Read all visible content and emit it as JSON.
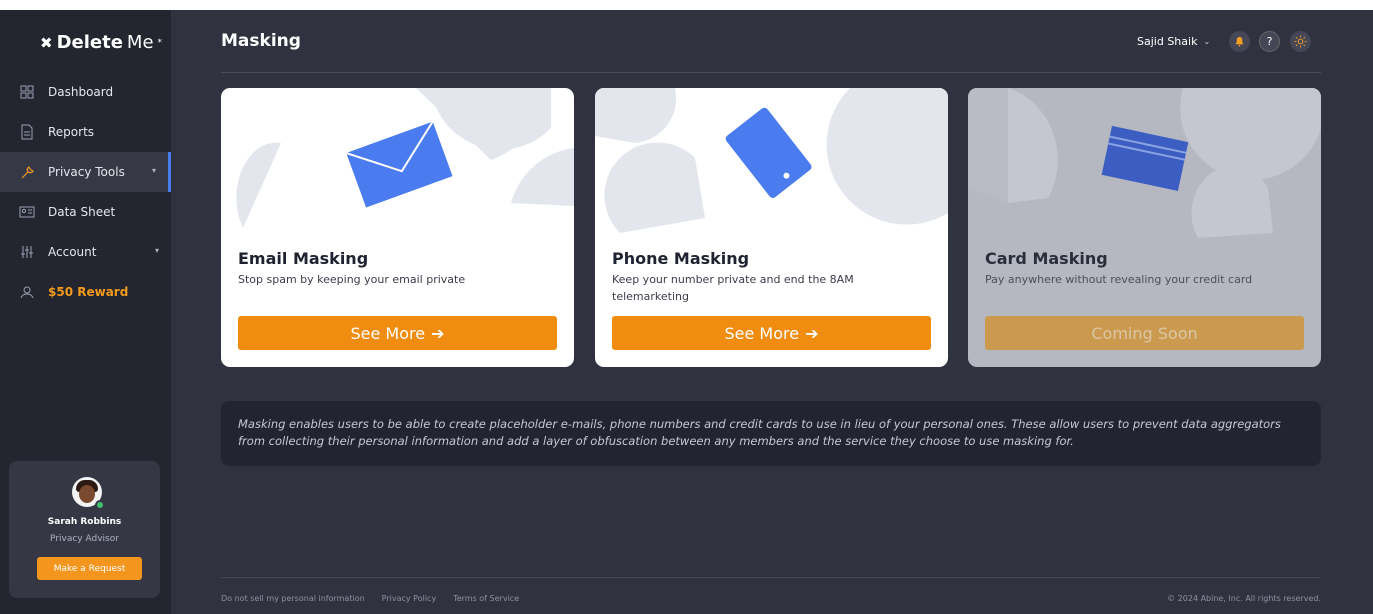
{
  "brand": {
    "name_bold": "Delete",
    "name_light": "Me",
    "sup": "*"
  },
  "sidebar": {
    "items": [
      {
        "label": "Dashboard",
        "icon": "grid-icon"
      },
      {
        "label": "Reports",
        "icon": "document-icon"
      },
      {
        "label": "Privacy Tools",
        "icon": "wrench-icon",
        "caret": "▾"
      },
      {
        "label": "Data Sheet",
        "icon": "id-card-icon"
      },
      {
        "label": "Account",
        "icon": "sliders-icon",
        "caret": "▾"
      },
      {
        "label": "$50 Reward",
        "icon": "user-icon"
      }
    ],
    "advisor": {
      "name": "Sarah Robbins",
      "role": "Privacy Advisor",
      "button": "Make a Request"
    }
  },
  "header": {
    "title": "Masking",
    "user": "Sajid Shaik",
    "help": "?"
  },
  "cards": [
    {
      "title": "Email Masking",
      "desc": "Stop spam by keeping your email private",
      "button": "See More",
      "arrow": "➔"
    },
    {
      "title": "Phone Masking",
      "desc": "Keep your number private and end the 8AM telemarketing",
      "button": "See More",
      "arrow": "➔"
    },
    {
      "title": "Card Masking",
      "desc": "Pay anywhere without revealing your credit card",
      "button": "Coming Soon"
    }
  ],
  "info": "Masking enables users to be able to create placeholder e-mails, phone numbers and credit cards to use in lieu of your personal ones. These allow users to prevent data aggregators from collecting their personal information and add a layer of obfuscation between any members and the service they choose to use masking for.",
  "footer": {
    "links": [
      "Do not sell my personal information",
      "Privacy Policy",
      "Terms of Service"
    ],
    "copyright": "© 2024 Abine, Inc. All rights reserved."
  },
  "colors": {
    "accent": "#f08c0f",
    "active_bar": "#4a7cf0",
    "icon_blue": "#4a7cf0"
  }
}
